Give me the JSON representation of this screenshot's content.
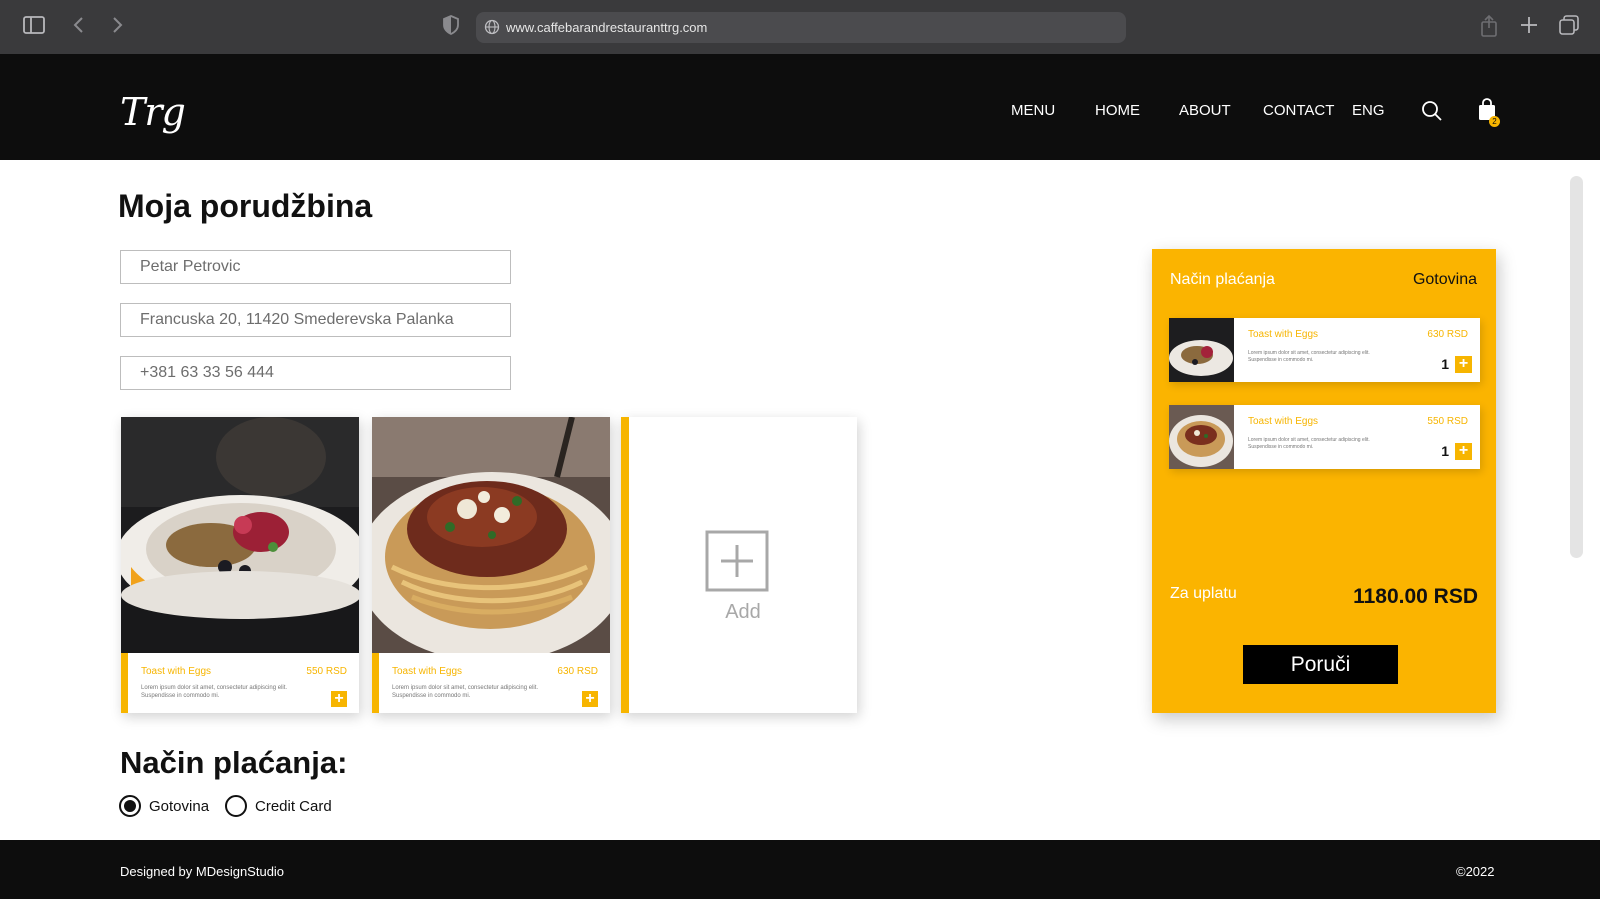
{
  "browser": {
    "url": "www.caffebarandrestauranttrg.com"
  },
  "header": {
    "logo": "Trg",
    "nav": [
      "MENU",
      "HOME",
      "ABOUT",
      "CONTACT",
      "ENG"
    ],
    "cart_count": "2"
  },
  "order_form": {
    "title": "Moja porudžbina",
    "name": "Petar Petrovic",
    "address": "Francuska 20, 11420 Smederevska Palanka",
    "phone": "+381 63 33 56 444"
  },
  "menu_cards": [
    {
      "name": "Toast with Eggs",
      "price": "550 RSD",
      "description": "Lorem ipsum dolor sit amet, consectetur adipiscing elit. Suspendisse in commodo mi.",
      "image": "fish-dish-photo"
    },
    {
      "name": "Toast with Eggs",
      "price": "630 RSD",
      "description": "Lorem ipsum dolor sit amet, consectetur adipiscing elit. Suspendisse in commodo mi.",
      "image": "spaghetti-photo"
    }
  ],
  "add_card": {
    "label": "Add"
  },
  "payment": {
    "title": "Način plaćanja:",
    "options": [
      {
        "label": "Gotovina",
        "checked": true
      },
      {
        "label": "Credit Card",
        "checked": false
      }
    ]
  },
  "summary": {
    "title": "Način plaćanja",
    "method": "Gotovina",
    "items": [
      {
        "name": "Toast with Eggs",
        "price": "630 RSD",
        "description": "Lorem ipsum dolor sit amet, consectetur adipiscing elit. Suspendisse in commodo mi.",
        "qty": "1"
      },
      {
        "name": "Toast with Eggs",
        "price": "550 RSD",
        "description": "Lorem ipsum dolor sit amet, consectetur adipiscing elit. Suspendisse in commodo mi.",
        "qty": "1"
      }
    ],
    "total_label": "Za uplatu",
    "total_value": "1180.00 RSD",
    "order_button": "Poruči"
  },
  "footer": {
    "credit": "Designed by MDesignStudio",
    "copyright": "©2022"
  },
  "colors": {
    "accent": "#fbb400",
    "header_bg": "#0d0d0d",
    "chrome_bg": "#3a3a3c"
  }
}
